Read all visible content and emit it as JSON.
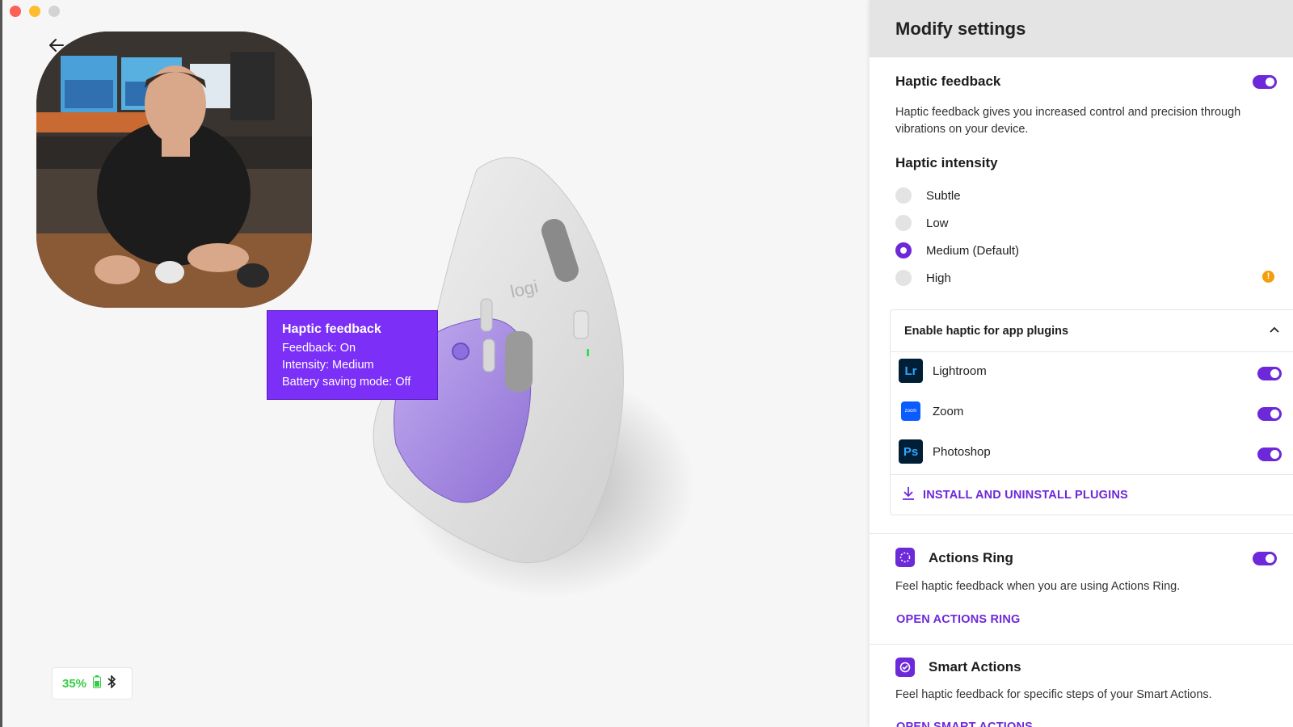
{
  "colors": {
    "accent": "#6d28d9",
    "tooltip_bg": "#7b2ff7",
    "battery_green": "#33cc44",
    "warning": "#f59e0b"
  },
  "device": {
    "battery_percent": "35%",
    "battery_icon": "battery-icon",
    "connection_icon": "bluetooth-icon",
    "brand_logo": "logi"
  },
  "tooltip": {
    "title": "Haptic feedback",
    "lines": [
      "Feedback: On",
      "Intensity: Medium",
      "Battery saving mode: Off"
    ]
  },
  "panel": {
    "title": "Modify settings",
    "haptic": {
      "title": "Haptic feedback",
      "enabled": true,
      "description": "Haptic feedback gives you increased control and precision through vibrations on your device.",
      "intensity_title": "Haptic intensity",
      "options": [
        {
          "label": "Subtle",
          "selected": false
        },
        {
          "label": "Low",
          "selected": false
        },
        {
          "label": "Medium (Default)",
          "selected": true
        },
        {
          "label": "High",
          "selected": false,
          "warning_icon": "info-warning-icon"
        }
      ]
    },
    "plugins": {
      "title": "Enable haptic for app plugins",
      "expanded": true,
      "items": [
        {
          "name": "Lightroom",
          "icon_text": "Lr",
          "enabled": true
        },
        {
          "name": "Zoom",
          "icon_text": "zoom",
          "enabled": true
        },
        {
          "name": "Photoshop",
          "icon_text": "Ps",
          "enabled": true
        }
      ],
      "install_link": "INSTALL AND UNINSTALL PLUGINS"
    },
    "actions_ring": {
      "title": "Actions Ring",
      "enabled": true,
      "description": "Feel haptic feedback when you are using Actions Ring.",
      "link": "OPEN ACTIONS RING"
    },
    "smart_actions": {
      "title": "Smart Actions",
      "description": "Feel haptic feedback for specific steps of your Smart Actions.",
      "link": "OPEN SMART ACTIONS"
    }
  }
}
